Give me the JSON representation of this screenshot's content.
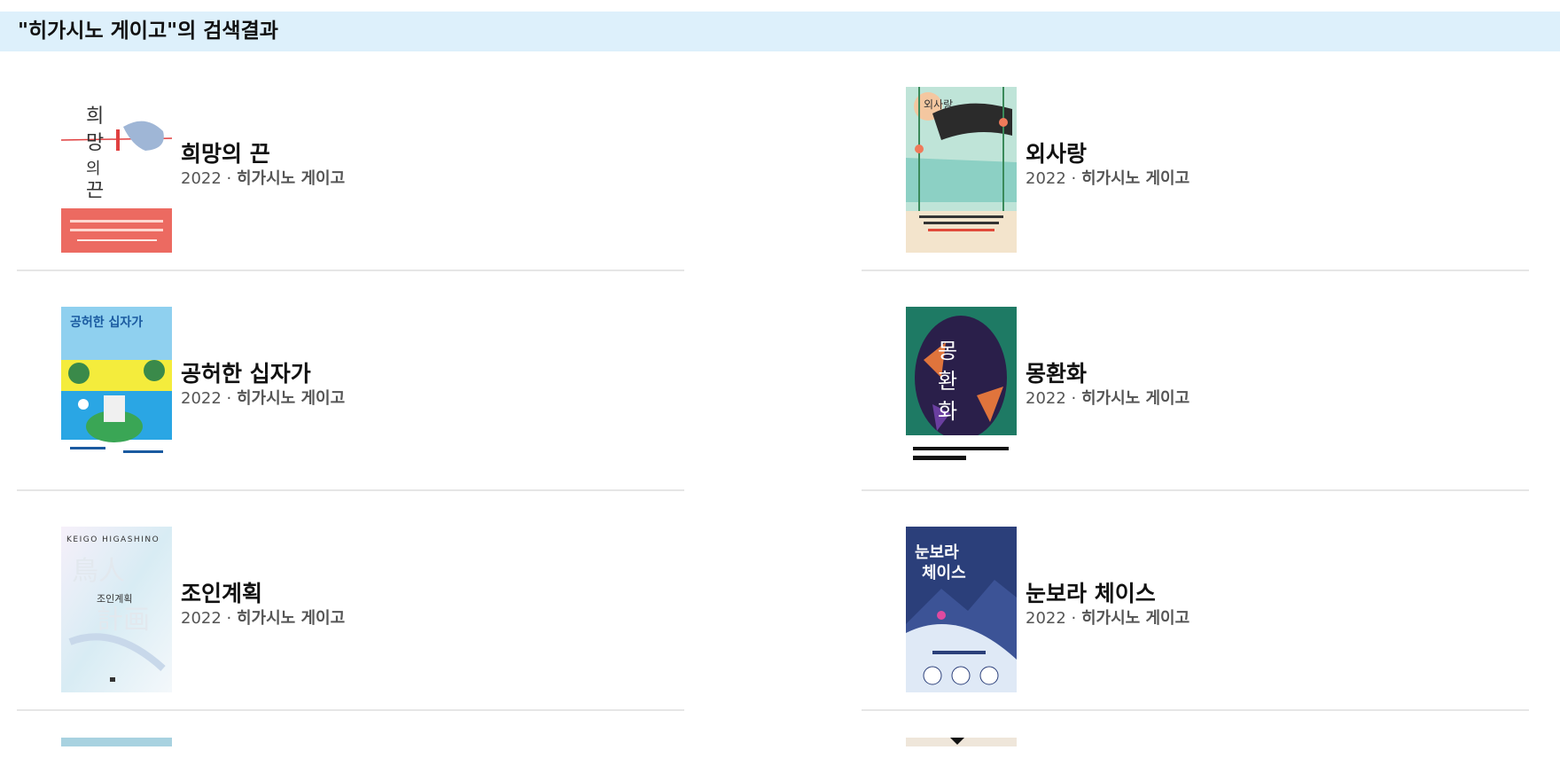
{
  "header": {
    "title": "\"히가시노 게이고\"의 검색결과"
  },
  "books": [
    {
      "title": "희망의 끈",
      "year": "2022",
      "separator": " · ",
      "author": "히가시노 게이고",
      "cover": {
        "bg": "#ffffff",
        "accent": "#ec6a61",
        "text": "희망의 끈"
      }
    },
    {
      "title": "외사랑",
      "year": "2022",
      "separator": " · ",
      "author": "히가시노 게이고",
      "cover": {
        "bg": "#bfe4d8",
        "accent": "#f07a5a",
        "text": "외사랑"
      }
    },
    {
      "title": "공허한 십자가",
      "year": "2022",
      "separator": " · ",
      "author": "히가시노 게이고",
      "cover": {
        "bg": "#f4ec3c",
        "accent": "#2aa6e4",
        "text": "공허한 십자가"
      }
    },
    {
      "title": "몽환화",
      "year": "2022",
      "separator": " · ",
      "author": "히가시노 게이고",
      "cover": {
        "bg": "#1e7a64",
        "accent": "#e0743c",
        "text": "몽환화"
      }
    },
    {
      "title": "조인계획",
      "year": "2022",
      "separator": " · ",
      "author": "히가시노 게이고",
      "cover": {
        "bg": "#eef4f8",
        "accent": "#c8d8ea",
        "text": "KEIGO HIGASHINO"
      }
    },
    {
      "title": "눈보라 체이스",
      "year": "2022",
      "separator": " · ",
      "author": "히가시노 게이고",
      "cover": {
        "bg": "#2b3f7a",
        "accent": "#7fd0f0",
        "text": "눈보라 체이스"
      }
    }
  ]
}
